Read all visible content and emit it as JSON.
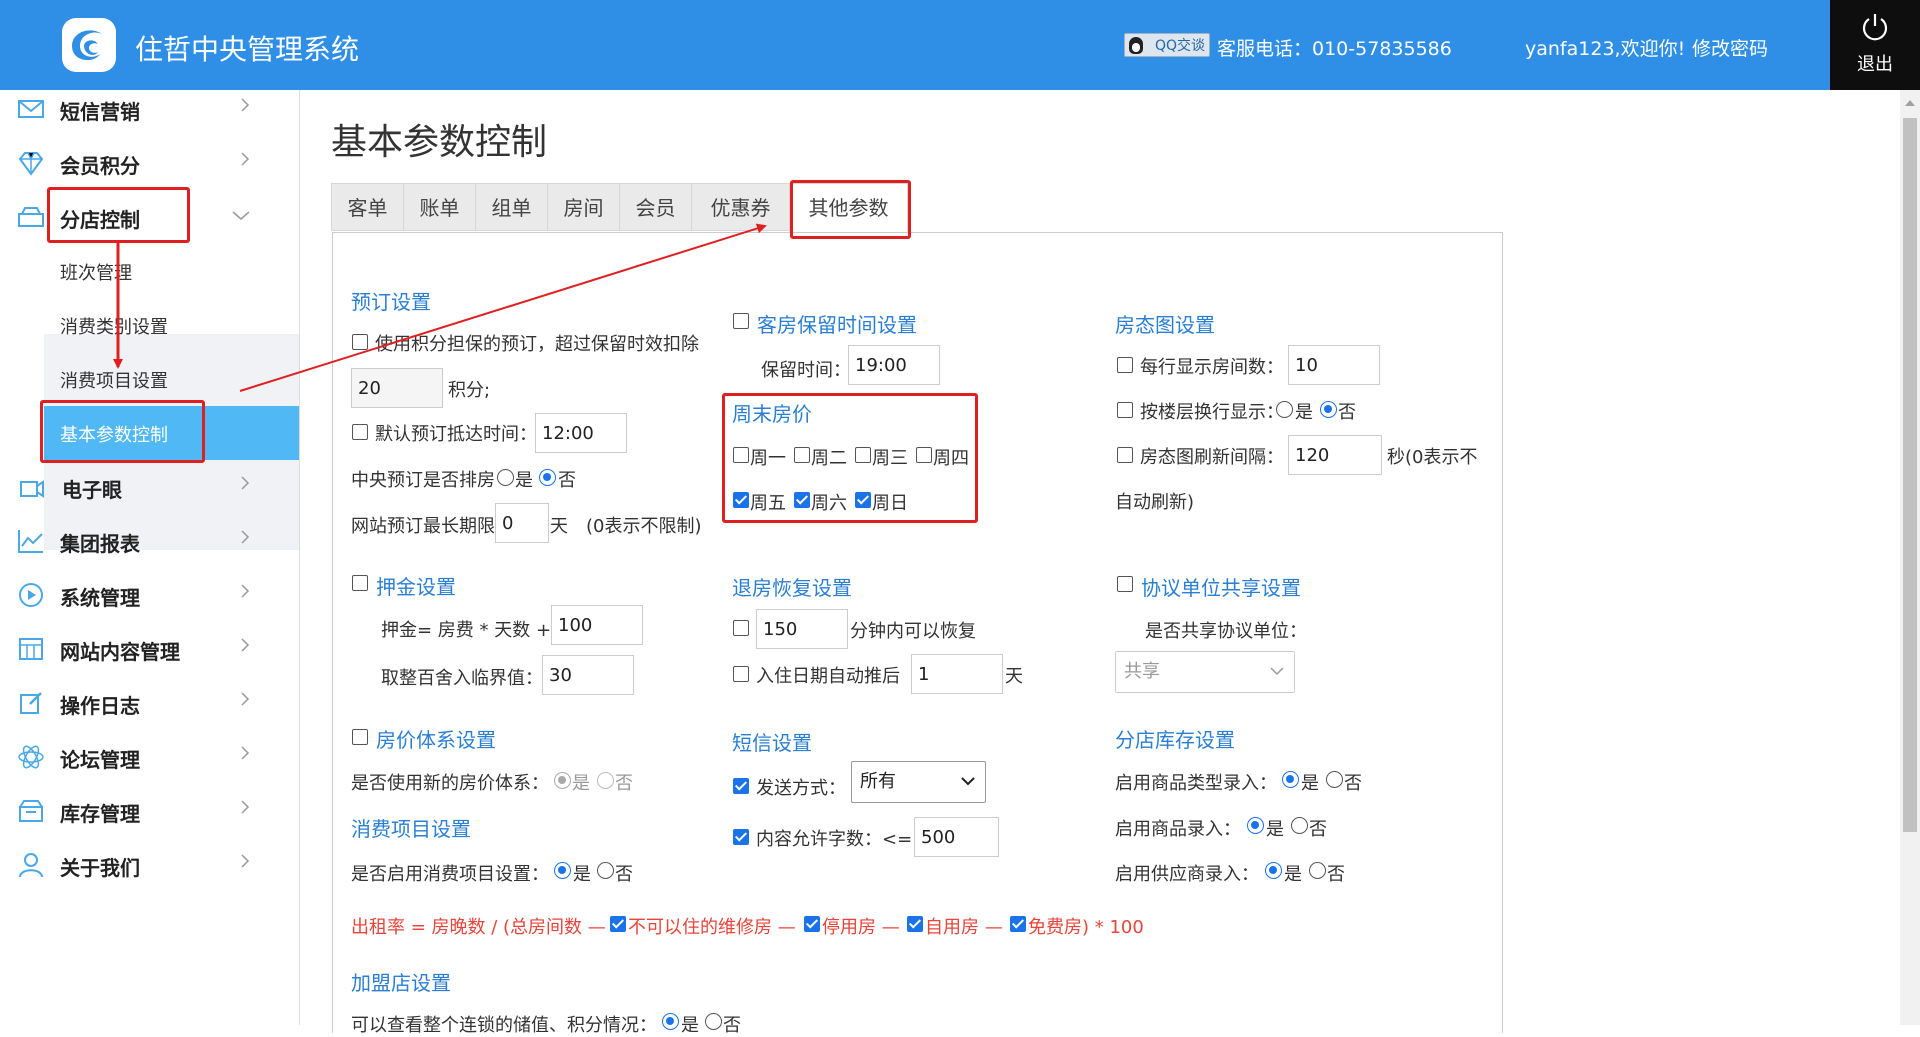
{
  "header": {
    "app_title": "住哲中央管理系统",
    "qq_badge": "QQ交谈",
    "service_phone": "客服电话：010-57835586",
    "user": "yanfa123,欢迎你!",
    "change_password": "修改密码",
    "logout": "退出",
    "color": "#2f8fe6"
  },
  "sidebar": {
    "items": [
      {
        "label": "短信营销",
        "icon": "envelope-icon"
      },
      {
        "label": "会员积分",
        "icon": "diamond-icon"
      },
      {
        "label": "分店控制",
        "icon": "store-icon"
      },
      {
        "label": "电子眼",
        "icon": "camera-icon"
      },
      {
        "label": "集团报表",
        "icon": "chart-icon"
      },
      {
        "label": "系统管理",
        "icon": "play-icon"
      },
      {
        "label": "网站内容管理",
        "icon": "grid-icon"
      },
      {
        "label": "操作日志",
        "icon": "edit-icon"
      },
      {
        "label": "论坛管理",
        "icon": "atom-icon"
      },
      {
        "label": "库存管理",
        "icon": "box-icon"
      },
      {
        "label": "关于我们",
        "icon": "user-icon"
      }
    ],
    "submenu": [
      "班次管理",
      "消费类别设置",
      "消费项目设置",
      "基本参数控制"
    ],
    "active_color": "#4fb8f5"
  },
  "main": {
    "page_title": "基本参数控制",
    "tabs": [
      "客单",
      "账单",
      "组单",
      "房间",
      "会员",
      "优惠券",
      "其他参数"
    ],
    "active_tab": "其他参数"
  },
  "booking": {
    "title": "预订设置",
    "use_points": "使用积分担保的预订，超过保留时效扣除",
    "points_value": "20",
    "points_unit": "积分;",
    "default_arrival": "默认预订抵达时间：",
    "arrival_value": "12:00",
    "central_room": "中央预订是否排房",
    "yes": "是",
    "no": "否",
    "max_period": "网站预订最长期限",
    "max_value": "0",
    "max_unit": "天　(0表示不限制)"
  },
  "room_hold": {
    "title": "客房保留时间设置",
    "hold_label": "保留时间：",
    "hold_value": "19:00"
  },
  "weekend": {
    "title": "周末房价",
    "days": [
      "周一",
      "周二",
      "周三",
      "周四",
      "周五",
      "周六",
      "周日"
    ],
    "checked": [
      false,
      false,
      false,
      false,
      true,
      true,
      true
    ]
  },
  "room_map": {
    "title": "房态图设置",
    "per_row": "每行显示房间数：",
    "per_row_value": "10",
    "by_floor": "按楼层换行显示：",
    "refresh": "房态图刷新间隔：",
    "refresh_value": "120",
    "refresh_unit": "秒(0表示不",
    "refresh_unit2": "自动刷新)"
  },
  "deposit": {
    "title": "押金设置",
    "formula": "押金= 房费 * 天数 +",
    "formula_value": "100",
    "round": "取整百舍入临界值：",
    "round_value": "30"
  },
  "checkout": {
    "title": "退房恢复设置",
    "minutes_value": "150",
    "minutes_label": "分钟内可以恢复",
    "postpone": "入住日期自动推后",
    "postpone_value": "1",
    "postpone_unit": "天"
  },
  "agreement": {
    "title": "协议单位共享设置",
    "share_label": "是否共享协议单位：",
    "share_value": "共享"
  },
  "price_system": {
    "title": "房价体系设置",
    "use_new": "是否使用新的房价体系："
  },
  "sms": {
    "title": "短信设置",
    "send_mode": "发送方式：",
    "send_value": "所有",
    "chars": "内容允许字数：<=",
    "chars_value": "500"
  },
  "stock": {
    "title": "分店库存设置",
    "type_entry": "启用商品类型录入：",
    "goods_entry": "启用商品录入：",
    "supplier_entry": "启用供应商录入："
  },
  "consume": {
    "title": "消费项目设置",
    "enable": "是否启用消费项目设置："
  },
  "occupancy": {
    "prefix": "出租率 = 房晚数 / (总房间数 —",
    "part1": "不可以住的维修房 —",
    "part2": "停用房 —",
    "part3": "自用房 —",
    "part4": "免费房) * 100",
    "color": "#e8443a"
  },
  "franchise": {
    "title": "加盟店设置",
    "view_chain": "可以查看整个连锁的储值、积分情况："
  }
}
